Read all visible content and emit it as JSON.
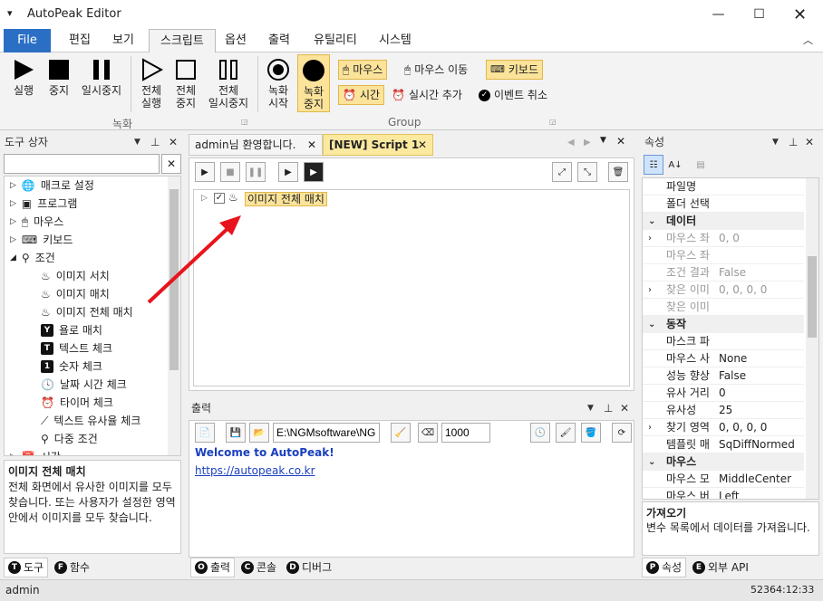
{
  "app": {
    "title": "AutoPeak Editor"
  },
  "menu": {
    "file": "File",
    "tabs": [
      "편집",
      "보기",
      "스크립트",
      "옵션",
      "출력",
      "유틸리티",
      "시스템"
    ]
  },
  "ribbon": {
    "run": "실행",
    "stop": "중지",
    "pause": "일시중지",
    "run_all_1": "전체",
    "run_all_2": "실행",
    "stop_all_1": "전체",
    "stop_all_2": "중지",
    "pause_all_1": "전체",
    "pause_all_2": "일시중지",
    "rec_start_1": "녹화",
    "rec_start_2": "시작",
    "rec_stop_1": "녹화",
    "rec_stop_2": "중지",
    "mouse": "마우스",
    "mouse_move": "마우스 이동",
    "keyboard": "키보드",
    "time": "시간",
    "add_realtime": "실시간 추가",
    "cancel_event": "이벤트 취소",
    "group_rec": "녹화",
    "group_group": "Group"
  },
  "toolbox": {
    "title": "도구 상자",
    "search_value": "",
    "items": [
      "매크로 설정",
      "프로그램",
      "마우스",
      "키보드",
      "조건",
      "이미지 서치",
      "이미지 매치",
      "이미지 전체 매치",
      "욜로 매치",
      "텍스트 체크",
      "숫자 체크",
      "날짜 시간 체크",
      "타이머 체크",
      "텍스트 유사율 체크",
      "다중 조건",
      "시간"
    ],
    "desc_title": "이미지 전체 매치",
    "desc_text": "전체 화면에서 유사한 이미지를 모두 찾습니다. 또는 사용자가 설정한 영역 안에서 이미지를 모두 찾습니다.",
    "tab_tool": "도구",
    "tab_func": "함수"
  },
  "editor": {
    "tab1": "admin님 환영합니다.",
    "tab2": "[NEW] Script 1",
    "node_label": "이미지 전체 매치"
  },
  "output": {
    "title": "출력",
    "path": "E:\\NGMsoftware\\NG",
    "count": "1000",
    "welcome": "Welcome to AutoPeak!",
    "link": "https://autopeak.co.kr",
    "tab_output": "출력",
    "tab_console": "콘솔",
    "tab_debug": "디버그"
  },
  "props": {
    "title": "속성",
    "rows": [
      {
        "t": "row",
        "k": "파일명",
        "v": ""
      },
      {
        "t": "row",
        "k": "폴더 선택",
        "v": ""
      },
      {
        "t": "cat",
        "k": "데이터"
      },
      {
        "t": "row",
        "k": "마우스 좌",
        "v": "0, 0",
        "exp": true,
        "dis": true
      },
      {
        "t": "row",
        "k": "마우스 좌",
        "v": "",
        "dis": true
      },
      {
        "t": "row",
        "k": "조건 결과",
        "v": "False",
        "dis": true
      },
      {
        "t": "row",
        "k": "찾은 이미",
        "v": "0, 0, 0, 0",
        "exp": true,
        "dis": true
      },
      {
        "t": "row",
        "k": "찾은 이미",
        "v": "",
        "dis": true
      },
      {
        "t": "cat",
        "k": "동작"
      },
      {
        "t": "row",
        "k": "마스크 파",
        "v": ""
      },
      {
        "t": "row",
        "k": "마우스 사",
        "v": "None"
      },
      {
        "t": "row",
        "k": "성능 향상",
        "v": "False"
      },
      {
        "t": "row",
        "k": "유사 거리",
        "v": "0"
      },
      {
        "t": "row",
        "k": "유사성",
        "v": "25"
      },
      {
        "t": "row",
        "k": "찾기 영역",
        "v": "0, 0, 0, 0",
        "exp": true
      },
      {
        "t": "row",
        "k": "템플릿 매",
        "v": "SqDiffNormed"
      },
      {
        "t": "cat",
        "k": "마우스"
      },
      {
        "t": "row",
        "k": "마우스 모",
        "v": "MiddleCenter"
      },
      {
        "t": "row",
        "k": "마우스 버",
        "v": "Left"
      }
    ],
    "desc_title": "가져오기",
    "desc_text": "변수 목록에서 데이터를 가져옵니다.",
    "tab_props": "속성",
    "tab_api": "외부 API"
  },
  "status": {
    "user": "admin",
    "time": "52364:12:33"
  },
  "colors": {
    "accent": "#2b6fc5",
    "highlight": "#fbe39a",
    "arrow": "#e8141c",
    "link": "#1a3fbf"
  }
}
